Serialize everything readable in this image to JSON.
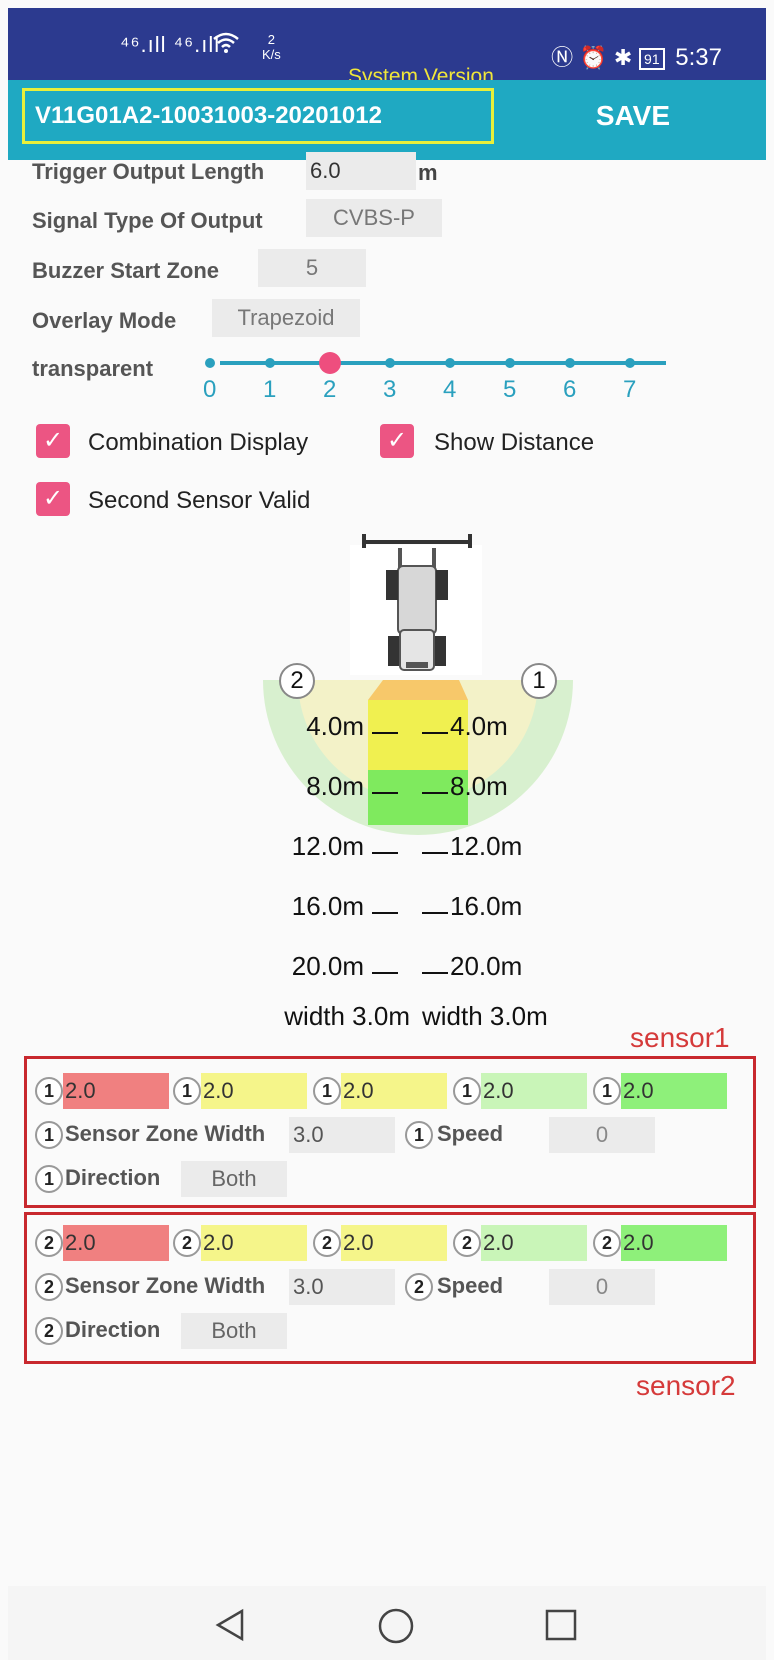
{
  "statusbar": {
    "signal_left": "⁴⁶.ıll ⁴⁶.ıll",
    "speed_value": "2",
    "speed_unit": "K/s",
    "battery": "91",
    "time": "5:37",
    "system_version_label": "System Version"
  },
  "toolbar": {
    "version": "V11G01A2-10031003-20201012",
    "save_label": "SAVE"
  },
  "settings": {
    "trigger_label": "Trigger Output Length",
    "trigger_value": "6.0",
    "trigger_unit": "m",
    "signal_label": "Signal Type Of Output",
    "signal_value": "CVBS-P",
    "buzzer_label": "Buzzer Start Zone",
    "buzzer_value": "5",
    "overlay_label": "Overlay Mode",
    "overlay_value": "Trapezoid",
    "transparent_label": "transparent",
    "transparent_ticks": [
      "0",
      "1",
      "2",
      "3",
      "4",
      "5",
      "6",
      "7"
    ],
    "transparent_value": 2
  },
  "checkboxes": {
    "combination": "Combination Display",
    "show_distance": "Show Distance",
    "second_sensor": "Second Sensor Valid",
    "check_glyph": "✓"
  },
  "diagram": {
    "sensor2_marker": "2",
    "sensor1_marker": "1",
    "distances": [
      {
        "left": "4.0m",
        "right": "4.0m"
      },
      {
        "left": "8.0m",
        "right": "8.0m"
      },
      {
        "left": "12.0m",
        "right": "12.0m"
      },
      {
        "left": "16.0m",
        "right": "16.0m"
      },
      {
        "left": "20.0m",
        "right": "20.0m"
      }
    ],
    "width_left": "width 3.0m",
    "width_right": "width 3.0m"
  },
  "sensor1": {
    "title": "sensor1",
    "num": "1",
    "zones": [
      "2.0",
      "2.0",
      "2.0",
      "2.0",
      "2.0"
    ],
    "zone_width_label": "Sensor Zone Width",
    "zone_width_value": "3.0",
    "speed_label": "Speed",
    "speed_value": "0",
    "direction_label": "Direction",
    "direction_value": "Both"
  },
  "sensor2": {
    "title": "sensor2",
    "num": "2",
    "zones": [
      "2.0",
      "2.0",
      "2.0",
      "2.0",
      "2.0"
    ],
    "zone_width_label": "Sensor Zone Width",
    "zone_width_value": "3.0",
    "speed_label": "Speed",
    "speed_value": "0",
    "direction_label": "Direction",
    "direction_value": "Both"
  },
  "colors": {
    "statusbar": "#2c3a8f",
    "toolbar": "#1fa9c2",
    "accent_pink": "#ec5583",
    "zone_red": "#f08080",
    "zone_yellow": "#f5f58a",
    "zone_lightgreen": "#c9f5b8",
    "zone_green": "#8ef07a"
  }
}
